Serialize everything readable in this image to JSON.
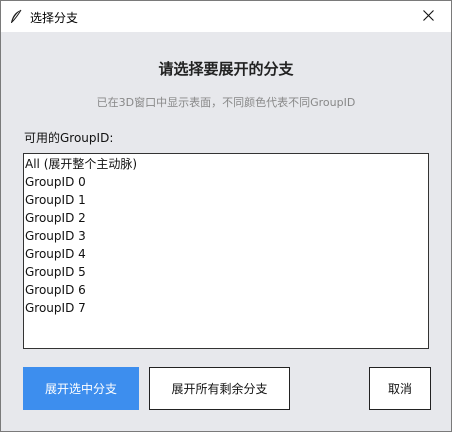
{
  "window": {
    "title": "选择分支"
  },
  "dialog": {
    "heading": "请选择要展开的分支",
    "subtitle": "已在3D窗口中显示表面，不同颜色代表不同GroupID",
    "list_label": "可用的GroupID:",
    "items": [
      "All (展开整个主动脉)",
      "GroupID 0",
      "GroupID 1",
      "GroupID 2",
      "GroupID 3",
      "GroupID 4",
      "GroupID 5",
      "GroupID 6",
      "GroupID 7"
    ]
  },
  "buttons": {
    "expand_selected": "展开选中分支",
    "expand_all_remaining": "展开所有剩余分支",
    "cancel": "取消"
  },
  "colors": {
    "primary": "#3d8eee",
    "background": "#e7e8ec",
    "subtitle": "#888888"
  },
  "icons": {
    "app": "feather-icon",
    "close": "close-icon"
  }
}
